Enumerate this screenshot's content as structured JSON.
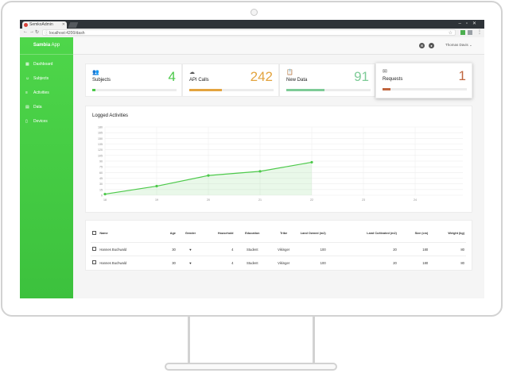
{
  "browser": {
    "tab_title": "SemkoAdmin",
    "url": "localhost:4200/dash"
  },
  "app": {
    "brand_bold": "Sambia",
    "brand_rest": " App",
    "menu": [
      {
        "label": "Dashboard",
        "icon": "dashboard-icon"
      },
      {
        "label": "Subjects",
        "icon": "subjects-icon"
      },
      {
        "label": "Activities",
        "icon": "activities-icon"
      },
      {
        "label": "Data",
        "icon": "data-icon"
      },
      {
        "label": "Devices",
        "icon": "devices-icon"
      }
    ],
    "user_name": "Thomas Davis"
  },
  "cards": [
    {
      "title": "Subjects",
      "value": "4",
      "color": "#4cc94a",
      "icon": "people-icon",
      "progress": 0.04
    },
    {
      "title": "API Calls",
      "value": "242",
      "color": "#e3a43f",
      "icon": "cloud-icon",
      "progress": 0.39
    },
    {
      "title": "New Data",
      "value": "91",
      "color": "#7ecb97",
      "icon": "clipboard-icon",
      "progress": 0.45
    },
    {
      "title": "Requests",
      "value": "1",
      "color": "#c0653e",
      "icon": "envelope-icon",
      "progress": 0.09
    }
  ],
  "chart_title": "Logged Activities",
  "chart_data": {
    "type": "area",
    "title": "Logged Activities",
    "x": [
      "18",
      "19",
      "20",
      "21",
      "22",
      "23",
      "24"
    ],
    "series": [
      {
        "values": [
          3,
          24,
          52,
          63,
          87,
          null,
          null
        ]
      }
    ],
    "ylim": [
      0,
      180
    ],
    "yticks": [
      0,
      15,
      30,
      45,
      60,
      75,
      90,
      105,
      120,
      135,
      150,
      165,
      180
    ],
    "grid": true,
    "color": "#4cc94a"
  },
  "table": {
    "headers": [
      "Name",
      "Age",
      "Gender",
      "Household",
      "Education",
      "Tribe",
      "Land Owned (m2)",
      "Land Cultivated (m2)",
      "Size (cm)",
      "Weight (kg)"
    ],
    "rows": [
      [
        "Hannes Buchwald",
        "30",
        "♥",
        "4",
        "Student",
        "Vikinger",
        "100",
        "20",
        "180",
        "80"
      ],
      [
        "Hannes Buchwald",
        "30",
        "♥",
        "4",
        "Student",
        "Vikinger",
        "100",
        "20",
        "180",
        "80"
      ]
    ]
  }
}
